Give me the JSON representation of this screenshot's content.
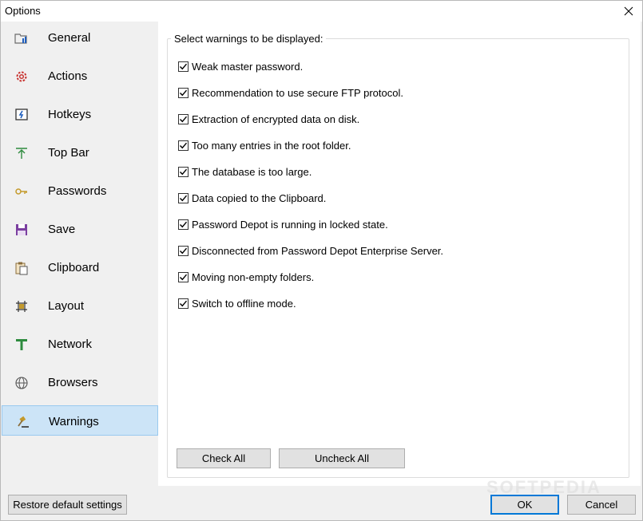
{
  "window": {
    "title": "Options",
    "close_glyph": "×"
  },
  "sidebar": {
    "items": [
      {
        "label": "General",
        "icon": "folder-settings-icon"
      },
      {
        "label": "Actions",
        "icon": "gear-icon"
      },
      {
        "label": "Hotkeys",
        "icon": "keyboard-key-icon"
      },
      {
        "label": "Top Bar",
        "icon": "arrow-top-bar-icon"
      },
      {
        "label": "Passwords",
        "icon": "key-icon"
      },
      {
        "label": "Save",
        "icon": "floppy-disk-icon"
      },
      {
        "label": "Clipboard",
        "icon": "clipboard-icon"
      },
      {
        "label": "Layout",
        "icon": "layout-icon"
      },
      {
        "label": "Network",
        "icon": "network-icon"
      },
      {
        "label": "Browsers",
        "icon": "globe-icon"
      },
      {
        "label": "Warnings",
        "icon": "gavel-icon"
      }
    ],
    "active": "Warnings"
  },
  "warnings": {
    "legend": "Select warnings to be displayed:",
    "items": [
      {
        "label": "Weak master password.",
        "checked": true
      },
      {
        "label": "Recommendation to use secure FTP protocol.",
        "checked": true
      },
      {
        "label": "Extraction of encrypted data on disk.",
        "checked": true
      },
      {
        "label": "Too many entries in the root folder.",
        "checked": true
      },
      {
        "label": "The database is too large.",
        "checked": true
      },
      {
        "label": "Data copied to the Clipboard.",
        "checked": true
      },
      {
        "label": "Password Depot is running in locked state.",
        "checked": true
      },
      {
        "label": "Disconnected from Password Depot Enterprise Server.",
        "checked": true
      },
      {
        "label": "Moving non-empty folders.",
        "checked": true
      },
      {
        "label": "Switch to offline mode.",
        "checked": true
      }
    ],
    "check_all_label": "Check All",
    "uncheck_all_label": "Uncheck All"
  },
  "footer": {
    "restore_label": "Restore default settings",
    "ok_label": "OK",
    "cancel_label": "Cancel"
  },
  "watermark": "SOFTPEDIA",
  "colors": {
    "active_bg": "#cce4f7",
    "active_border": "#99c9ef",
    "default_button_border": "#0078d7"
  }
}
